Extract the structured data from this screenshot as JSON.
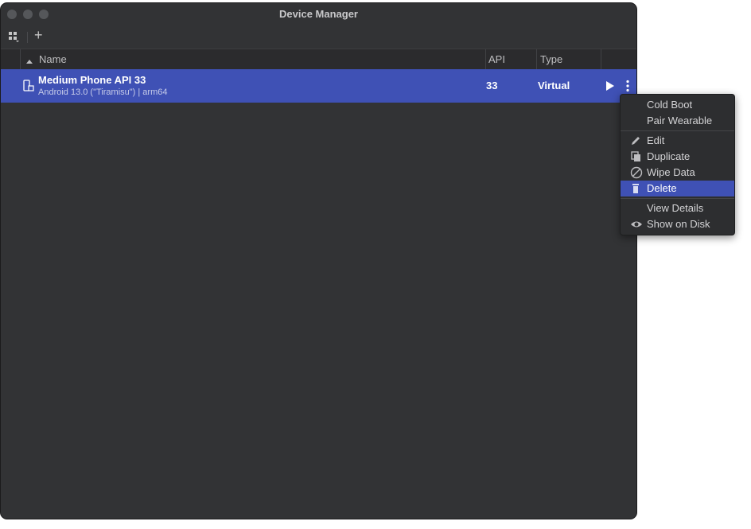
{
  "window": {
    "title": "Device Manager"
  },
  "toolbar": {
    "add_label": "+"
  },
  "table": {
    "columns": {
      "name": "Name",
      "api": "API",
      "type": "Type"
    },
    "rows": [
      {
        "name": "Medium Phone API 33",
        "subtitle": "Android 13.0 (\"Tiramisu\") | arm64",
        "api": "33",
        "type": "Virtual"
      }
    ]
  },
  "context_menu": {
    "items": [
      {
        "label": "Cold Boot"
      },
      {
        "label": "Pair Wearable"
      },
      {
        "label": "Edit",
        "icon": "pencil-icon"
      },
      {
        "label": "Duplicate",
        "icon": "duplicate-icon"
      },
      {
        "label": "Wipe Data",
        "icon": "wipe-icon"
      },
      {
        "label": "Delete",
        "icon": "trash-icon",
        "active": true
      },
      {
        "label": "View Details"
      },
      {
        "label": "Show on Disk",
        "icon": "eye-icon"
      }
    ]
  },
  "colors": {
    "selection": "#3f51b5",
    "window_bg": "#323335",
    "menu_bg": "#2d2e30"
  }
}
